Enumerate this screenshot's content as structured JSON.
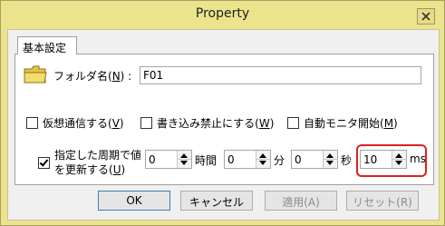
{
  "window": {
    "title": "Property"
  },
  "tab": {
    "label": "基本設定"
  },
  "folder": {
    "label": "フォルダ名(N) :",
    "label_pre": "フォルダ名(",
    "label_key": "N",
    "label_post": ") :",
    "value": "F01"
  },
  "checkboxes": [
    {
      "pre": "仮想通信する(",
      "key": "V",
      "post": ")",
      "checked": false
    },
    {
      "pre": "書き込み禁止にする(",
      "key": "W",
      "post": ")",
      "checked": false
    },
    {
      "pre": "自動モニタ開始(",
      "key": "M",
      "post": ")",
      "checked": false
    }
  ],
  "update": {
    "line1": "指定した周期で値",
    "line2_pre": "を更新する(",
    "line2_key": "U",
    "line2_post": ")",
    "checked": true
  },
  "intervals": [
    {
      "value": "0",
      "unit": "時間"
    },
    {
      "value": "0",
      "unit": "分"
    },
    {
      "value": "0",
      "unit": "秒"
    },
    {
      "value": "10",
      "unit": "ms"
    }
  ],
  "buttons": {
    "ok": "OK",
    "cancel": "キャンセル",
    "apply": "適用(A)",
    "reset": "リセット(R)"
  },
  "colors": {
    "titlebar": "#ece48d",
    "highlight": "#e02020"
  }
}
